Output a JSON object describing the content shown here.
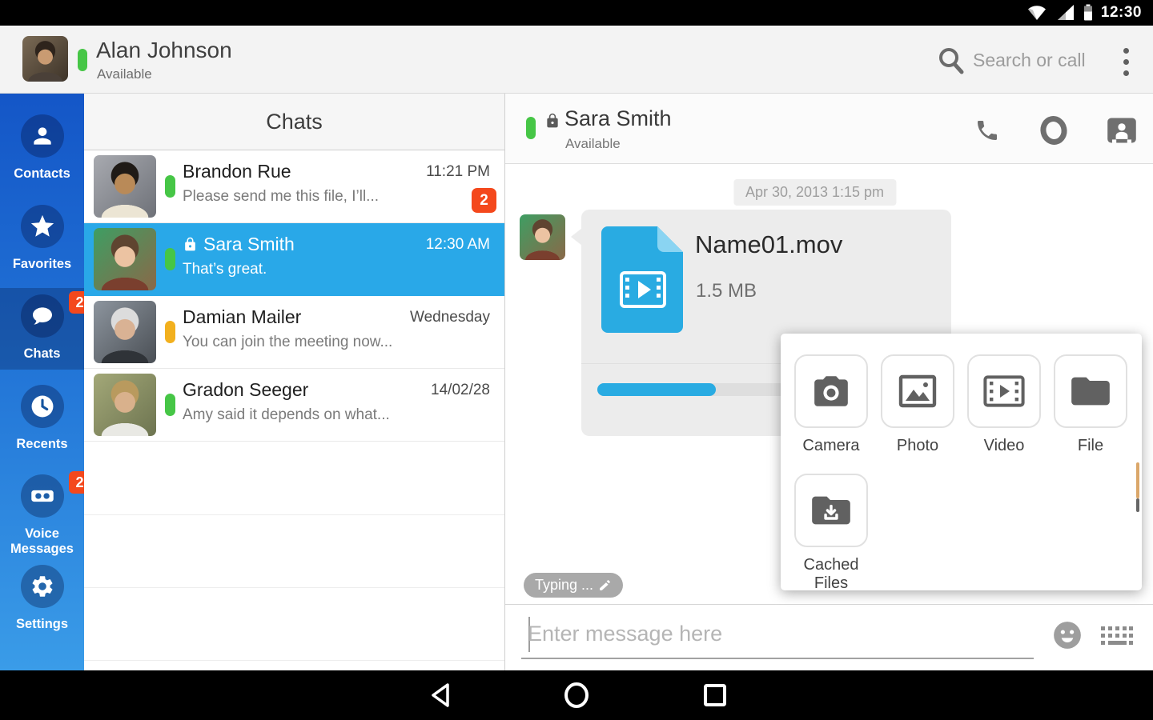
{
  "status_bar": {
    "time": "12:30"
  },
  "app_header": {
    "user_name": "Alan Johnson",
    "user_status": "Available",
    "search_label": "Search or call"
  },
  "sidebar": {
    "items": [
      {
        "label": "Contacts",
        "icon": "person-icon",
        "badge": ""
      },
      {
        "label": "Favorites",
        "icon": "star-icon",
        "badge": ""
      },
      {
        "label": "Chats",
        "icon": "chat-bubble-icon",
        "badge": "2",
        "selected": true
      },
      {
        "label": "Recents",
        "icon": "clock-icon",
        "badge": ""
      },
      {
        "label": "Voice Messages",
        "icon": "voicemail-icon",
        "badge": "2"
      },
      {
        "label": "Settings",
        "icon": "gear-icon",
        "badge": ""
      }
    ]
  },
  "chat_list": {
    "title": "Chats",
    "items": [
      {
        "name": "Brandon Rue",
        "preview": "Please send me this file, I’ll...",
        "time": "11:21 PM",
        "badge": "2",
        "presence": "available",
        "locked": false,
        "selected": false
      },
      {
        "name": "Sara Smith",
        "preview": "That’s great.",
        "time": "12:30 AM",
        "badge": "",
        "presence": "available",
        "locked": true,
        "selected": true
      },
      {
        "name": "Damian Mailer",
        "preview": "You can join the meeting now...",
        "time": "Wednesday",
        "badge": "",
        "presence": "away",
        "locked": false,
        "selected": false
      },
      {
        "name": "Gradon Seeger",
        "preview": "Amy said it depends on what...",
        "time": "14/02/28",
        "badge": "",
        "presence": "available",
        "locked": false,
        "selected": false
      }
    ]
  },
  "conversation": {
    "contact_name": "Sara Smith",
    "contact_status": "Available",
    "date_header": "Apr 30, 2013 1:15 pm",
    "file_message": {
      "filename": "Name01.mov",
      "filesize": "1.5 MB",
      "progress_percent": 35
    },
    "typing_indicator": "Typing ...",
    "input_placeholder": "Enter message here"
  },
  "attachment_popup": {
    "options": [
      {
        "label": "Camera",
        "icon": "camera-icon"
      },
      {
        "label": "Photo",
        "icon": "photo-icon"
      },
      {
        "label": "Video",
        "icon": "video-icon"
      },
      {
        "label": "File",
        "icon": "folder-icon"
      },
      {
        "label": "Cached Files",
        "icon": "cached-files-icon"
      }
    ]
  },
  "colors": {
    "accent_blue": "#29A8E8",
    "sidebar_top": "#1456C7",
    "sidebar_bottom": "#3A9CE8",
    "badge_orange": "#F4481C",
    "presence_available": "#46C646",
    "presence_away": "#F2B01E",
    "file_icon_blue": "#29ABE2"
  }
}
